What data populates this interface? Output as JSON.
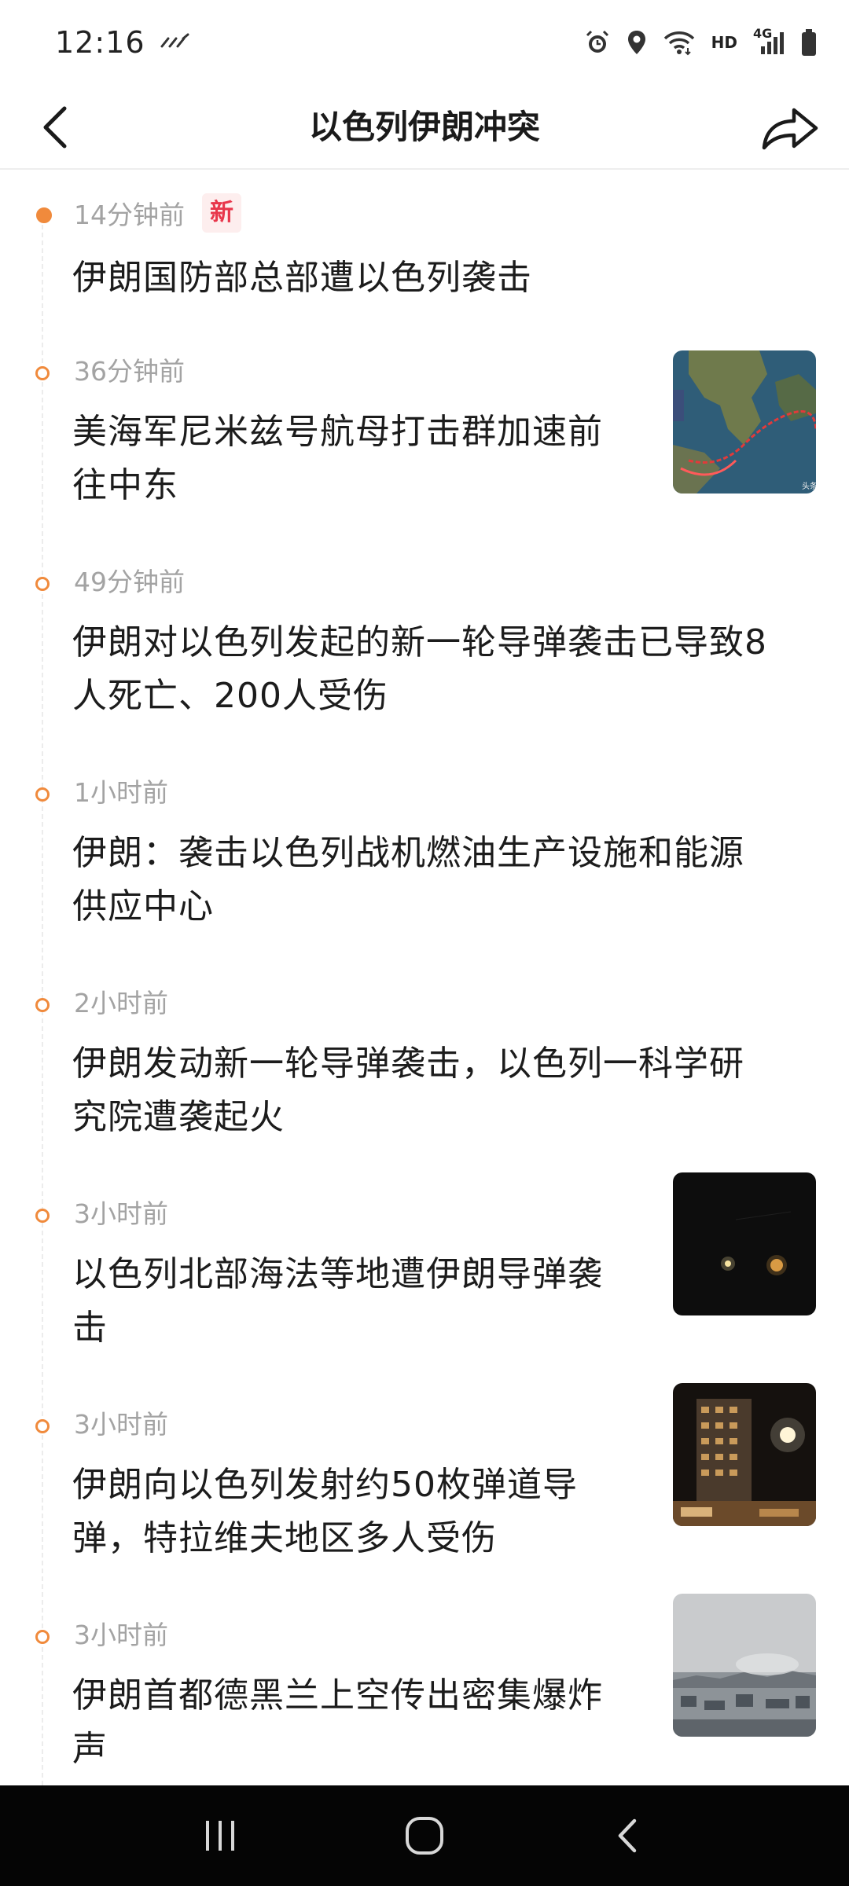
{
  "status_bar": {
    "time": "12:16",
    "network": "HD",
    "network_gen": "4G"
  },
  "header": {
    "title": "以色列伊朗冲突"
  },
  "timeline": {
    "items": [
      {
        "time": "14分钟前",
        "badge": "新",
        "headline_lines": [
          "伊朗国防部总部遭以色列袭击"
        ],
        "has_thumbnail": false
      },
      {
        "time": "36分钟前",
        "headline_lines": [
          "美海军尼米兹号航母打击群加速前",
          "往中东"
        ],
        "has_thumbnail": true,
        "thumbnail_kind": "map",
        "thumbnail_caption": "头条"
      },
      {
        "time": "49分钟前",
        "headline_lines": [
          "伊朗对以色列发起的新一轮导弹袭击已导致8",
          "人死亡、200人受伤"
        ],
        "has_thumbnail": false
      },
      {
        "time": "1小时前",
        "headline_lines": [
          "伊朗：袭击以色列战机燃油生产设施和能源",
          "供应中心"
        ],
        "has_thumbnail": false
      },
      {
        "time": "2小时前",
        "headline_lines": [
          "伊朗发动新一轮导弹袭击，以色列一科学研",
          "究院遭袭起火"
        ],
        "has_thumbnail": false
      },
      {
        "time": "3小时前",
        "headline_lines": [
          "以色列北部海法等地遭伊朗导弹袭",
          "击"
        ],
        "has_thumbnail": true,
        "thumbnail_kind": "night-sky"
      },
      {
        "time": "3小时前",
        "headline_lines": [
          "伊朗向以色列发射约50枚弹道导",
          "弹，特拉维夫地区多人受伤"
        ],
        "has_thumbnail": true,
        "thumbnail_kind": "building-night"
      },
      {
        "time": "3小时前",
        "headline_lines": [
          "伊朗首都德黑兰上空传出密集爆炸",
          "声"
        ],
        "has_thumbnail": true,
        "thumbnail_kind": "city-haze"
      }
    ]
  },
  "colors": {
    "accent": "#f08a3c",
    "badge_text": "#e8364b",
    "time_text": "#a3a3a3",
    "headline_text": "#1c1c1c",
    "nav_bar": "#050505"
  },
  "icons": {
    "back": "chevron-left-icon",
    "share": "share-arrow-icon",
    "nav_recent": "recent-apps-icon",
    "nav_home": "home-icon",
    "nav_back": "back-icon"
  }
}
